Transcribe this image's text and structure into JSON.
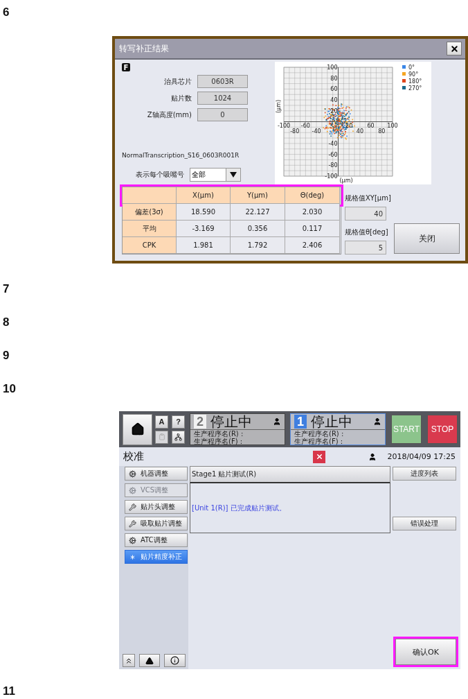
{
  "steps": [
    {
      "number": "6"
    },
    {
      "number": "7"
    },
    {
      "number": "8"
    },
    {
      "number": "9"
    },
    {
      "number": "10"
    },
    {
      "number": "11"
    }
  ],
  "transcription_dialog": {
    "title": "转写补正结果",
    "badge": "F",
    "fields": [
      {
        "label": "治具芯片",
        "value": "0603R"
      },
      {
        "label": "贴片数",
        "value": "1024"
      },
      {
        "label": "Z轴高度(mm)",
        "value": "0"
      }
    ],
    "program_name": "NormalTranscription_S16_0603R001R",
    "nozzle_select": {
      "label": "表示每个吸嘴号",
      "value": "全部"
    },
    "scatter_plot": {
      "x_ticks": [
        "-100",
        "-80",
        "-60",
        "-40",
        "20",
        "40",
        "60",
        "80",
        "100"
      ],
      "y_ticks": [
        "100",
        "80",
        "60",
        "40",
        "20",
        "-40",
        "-60",
        "-80",
        "-100"
      ],
      "x_unit": "(μm)",
      "y_unit": "(μm)",
      "legend": [
        {
          "label": "0°",
          "color": "#3a86e8"
        },
        {
          "label": "90°",
          "color": "#f5a623"
        },
        {
          "label": "180°",
          "color": "#e0461c"
        },
        {
          "label": "270°",
          "color": "#1a6a8c"
        }
      ]
    },
    "table": {
      "highlighted": true,
      "columns": [
        "X(μm)",
        "Y(μm)",
        "Θ(deg)"
      ],
      "rows": [
        {
          "label": "偏差(3σ)",
          "cells": [
            "18.590",
            "22.127",
            "2.030"
          ]
        },
        {
          "label": "平均",
          "cells": [
            "-3.169",
            "0.356",
            "0.117"
          ]
        },
        {
          "label": "CPK",
          "cells": [
            "1.981",
            "1.792",
            "2.406"
          ]
        }
      ]
    },
    "spec_xy": {
      "label": "规格值XY[μm]",
      "value": "40"
    },
    "spec_theta": {
      "label": "规格值θ[deg]",
      "value": "5"
    },
    "close_button": "关闭"
  },
  "calibration_screen": {
    "small_buttons": [
      "A",
      "?"
    ],
    "stages": [
      {
        "number": "2",
        "status": "停止中",
        "lines": [
          "生产程序名(R) :",
          "生产程序名(F) :"
        ],
        "selected": false
      },
      {
        "number": "1",
        "status": "停止中",
        "lines": [
          "生产程序名(R) :",
          "生产程序名(F) :"
        ],
        "selected": true
      }
    ],
    "start": "START",
    "stop": "STOP",
    "title": "校准",
    "datetime": "2018/04/09 17:25",
    "menu": [
      {
        "label": "机器调整",
        "disabled": false,
        "selected": false
      },
      {
        "label": "VCS调整",
        "disabled": true,
        "selected": false
      },
      {
        "label": "贴片头调整",
        "disabled": false,
        "selected": false
      },
      {
        "label": "吸取贴片调整",
        "disabled": false,
        "selected": false
      },
      {
        "label": "ATC调整",
        "disabled": false,
        "selected": false
      },
      {
        "label": "贴片精度补正",
        "disabled": false,
        "selected": true
      }
    ],
    "stage_header": "Stage1 贴片测试(R)",
    "message": "[Unit 1(R)] 已完成贴片测试。",
    "side_buttons": [
      "进度列表",
      "错误处理"
    ],
    "ok_button": {
      "label": "确认OK",
      "highlighted": true
    }
  }
}
